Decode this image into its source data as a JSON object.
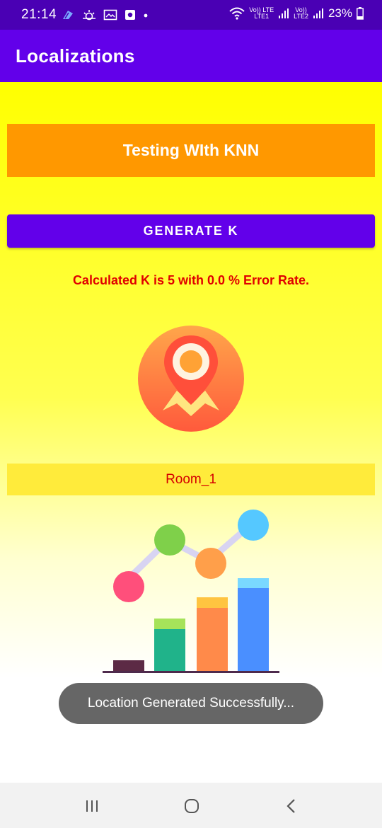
{
  "status_bar": {
    "time": "21:14",
    "battery": "23%",
    "sim1_label_top": "Vo)) LTE",
    "sim1_label_bottom": "LTE1",
    "sim2_label_top": "Vo))",
    "sim2_label_bottom": "LTE2"
  },
  "app_bar": {
    "title": "Localizations"
  },
  "main": {
    "title": "Testing WIth KNN",
    "generate_button": "GENERATE K",
    "result_text": "Calculated K is 5 with 0.0 % Error Rate.",
    "room_label": "Room_1"
  },
  "toast": {
    "message": "Location Generated Successfully..."
  },
  "icons": {
    "location_pin": "map-pin-icon",
    "analytics": "bar-chart-icon",
    "nav_recent": "recent-apps-icon",
    "nav_home": "home-icon",
    "nav_back": "back-icon"
  },
  "colors": {
    "status_bar": "#4a00b4",
    "app_bar": "#6200ea",
    "title_box": "#ff9800",
    "result_text": "#e00000",
    "room_bar": "#ffeb3b",
    "toast": "#666666"
  }
}
